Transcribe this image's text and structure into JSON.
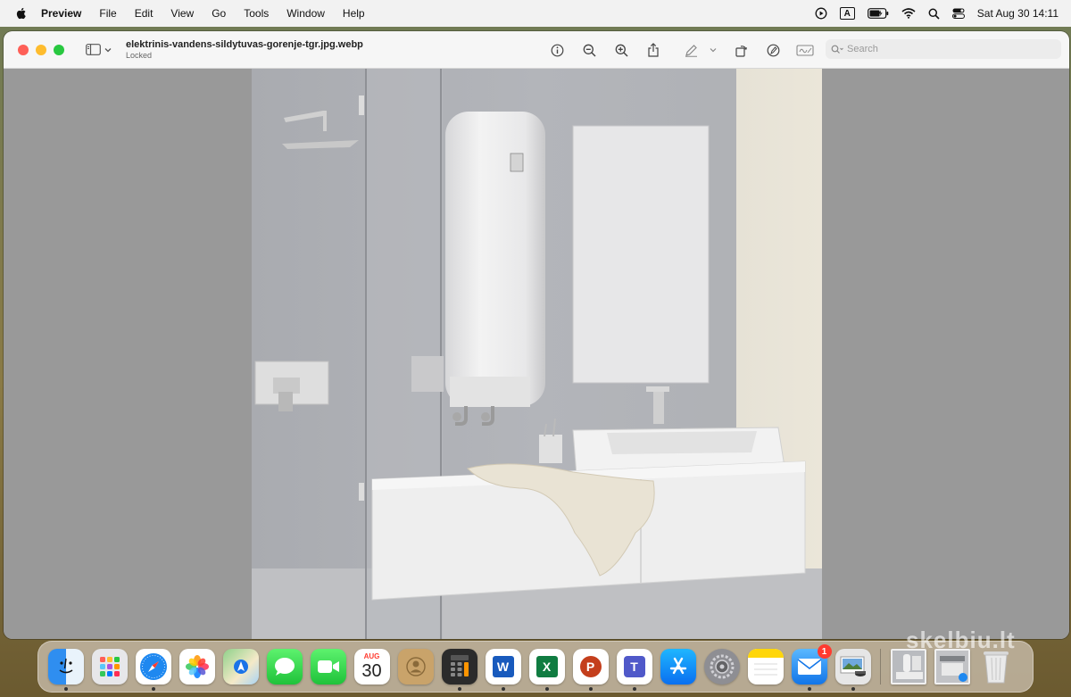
{
  "menubar": {
    "app_name": "Preview",
    "items": [
      "File",
      "Edit",
      "View",
      "Go",
      "Tools",
      "Window",
      "Help"
    ],
    "input_indicator": "A",
    "clock": "Sat Aug 30  14:11"
  },
  "window": {
    "title": "elektrinis-vandens-sildytuvas-gorenje-tgr.jpg.webp",
    "subtitle": "Locked",
    "search_placeholder": "Search"
  },
  "dock": {
    "calendar_month": "AUG",
    "calendar_day": "30",
    "mail_badge": "1",
    "word_letter": "W",
    "excel_letter": "X",
    "powerpoint_letter": "P",
    "teams_letter": "T"
  },
  "watermark": "skelbiu.lt",
  "colors": {
    "close": "#fe5f57",
    "minimize": "#febc2e",
    "maximize": "#28c840",
    "canvas": "#999999"
  }
}
